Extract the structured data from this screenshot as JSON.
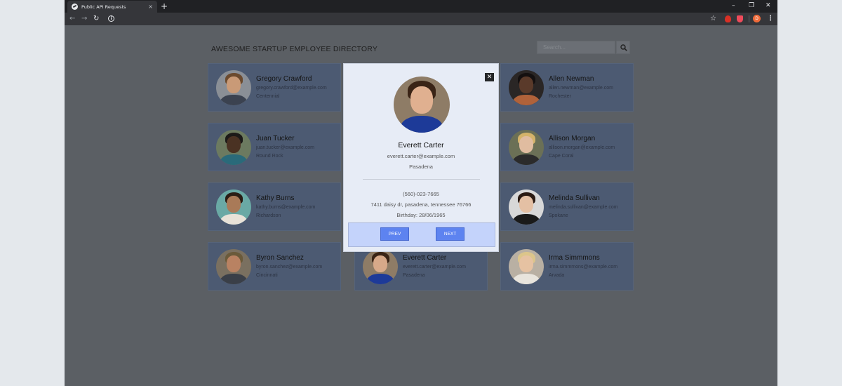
{
  "browser": {
    "tab_title": "Public API Requests",
    "tab_close": "×",
    "new_tab": "+",
    "controls": {
      "minimize": "–",
      "restore": "❐",
      "close": "✕"
    },
    "nav": {
      "back": "←",
      "forward": "→",
      "reload": "↻"
    },
    "site_info": "i",
    "star": "☆",
    "profile_initial": "D",
    "menu": "⋮"
  },
  "page": {
    "title": "AWESOME STARTUP EMPLOYEE DIRECTORY",
    "search_placeholder": "Search..."
  },
  "employees": [
    {
      "name": "Gregory Crawford",
      "email": "gregory.crawford@example.com",
      "city": "Centennial",
      "colors": {
        "bg": "#8a8f96",
        "hair": "#6b4a2e",
        "skin": "#c99a77",
        "shirt": "#3b4250"
      }
    },
    {
      "name": "Juan Tucker",
      "email": "juan.tucker@example.com",
      "city": "Round Rock",
      "colors": {
        "bg": "#6c7a60",
        "hair": "#1c1a18",
        "skin": "#4a3223",
        "shirt": "#2a6a7a"
      }
    },
    {
      "name": "Kathy Burns",
      "email": "kathy.burns@example.com",
      "city": "Richardson",
      "colors": {
        "bg": "#6aa9a5",
        "hair": "#2a1d15",
        "skin": "#a97a58",
        "shirt": "#e8e2d8"
      }
    },
    {
      "name": "Byron Sanchez",
      "email": "byron.sanchez@example.com",
      "city": "Cincinnati",
      "colors": {
        "bg": "#7a7060",
        "hair": "#6a5a3a",
        "skin": "#b98262",
        "shirt": "#3a3f48"
      }
    },
    {
      "name": "Everett Carter",
      "email": "everett.carter@example.com",
      "city": "Pasadena",
      "colors": {
        "bg": "#8e7c66",
        "hair": "#3a2416",
        "skin": "#d7a989",
        "shirt": "#1d3a98"
      }
    },
    {
      "name": "Allen Newman",
      "email": "allen.newman@example.com",
      "city": "Rochester",
      "colors": {
        "bg": "#2a2625",
        "hair": "#141010",
        "skin": "#5a3a2a",
        "shirt": "#b0623a"
      }
    },
    {
      "name": "Allison Morgan",
      "email": "allison.morgan@example.com",
      "city": "Cape Coral",
      "colors": {
        "bg": "#6b7056",
        "hair": "#d4b36a",
        "skin": "#e0bca0",
        "shirt": "#2b2b2b"
      }
    },
    {
      "name": "Melinda Sullivan",
      "email": "melinda.sullivan@example.com",
      "city": "Spokane",
      "colors": {
        "bg": "#d8d8d8",
        "hair": "#2a1a12",
        "skin": "#e4c0a4",
        "shirt": "#1a1a1a"
      }
    },
    {
      "name": "Irma Simmmons",
      "email": "irma.simmmons@example.com",
      "city": "Arvada",
      "colors": {
        "bg": "#b9b0a3",
        "hair": "#dcc58a",
        "skin": "#e6c2a2",
        "shirt": "#e8e4dc"
      }
    }
  ],
  "modal": {
    "close": "✕",
    "name": "Everett Carter",
    "email": "everett.carter@example.com",
    "city": "Pasadena",
    "phone": "(560)-023-7665",
    "address": "7411 daisy dr, pasadena, tennessee 76766",
    "birthday": "Birthday: 28/06/1965",
    "prev_label": "PREV",
    "next_label": "NEXT",
    "colors": {
      "bg": "#8e7c66",
      "hair": "#3a2416",
      "skin": "#e0b090",
      "shirt": "#1d3a98"
    }
  }
}
